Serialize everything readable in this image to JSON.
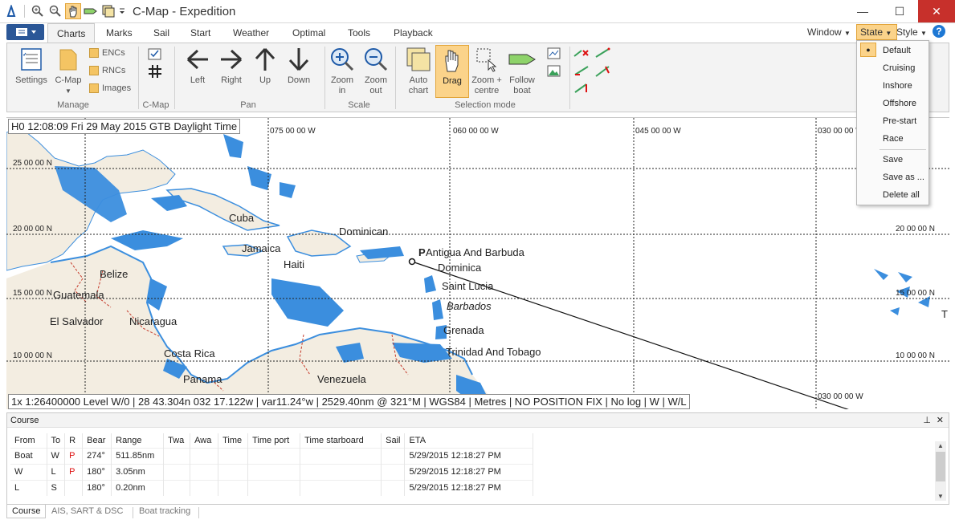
{
  "app": {
    "title": "C-Map - Expedition"
  },
  "window_controls": {
    "minimize": "—",
    "maximize": "☐",
    "close": "✕"
  },
  "ribbon_tabs": [
    "Charts",
    "Marks",
    "Sail",
    "Start",
    "Weather",
    "Optimal",
    "Tools",
    "Playback"
  ],
  "ribbon_right": {
    "window": "Window",
    "state": "State",
    "style": "Style",
    "help": "?"
  },
  "ribbon": {
    "settings": "Settings",
    "cmap": "C-Map",
    "encs": "ENCs",
    "rncs": "RNCs",
    "images": "Images",
    "left": "Left",
    "right": "Right",
    "up": "Up",
    "down": "Down",
    "zoom_in_1": "Zoom",
    "zoom_in_2": "in",
    "zoom_out_1": "Zoom",
    "zoom_out_2": "out",
    "auto_chart_1": "Auto",
    "auto_chart_2": "chart",
    "drag": "Drag",
    "zoom_centre_1": "Zoom +",
    "zoom_centre_2": "centre",
    "follow_boat_1": "Follow",
    "follow_boat_2": "boat",
    "groups": {
      "manage": "Manage",
      "cmap": "C-Map",
      "pan": "Pan",
      "scale": "Scale",
      "selection": "Selection mode"
    }
  },
  "map": {
    "time_readout": "H0 12:08:09 Fri 29 May 2015 GTB Daylight Time",
    "status_readout": "1x 1:26400000 Level W/0 | 28 43.304n 032 17.122w | var11.24°w | 2529.40nm @ 321°M | WGS84 | Metres | NO POSITION FIX | No log | W | W/L",
    "lon_labels": [
      "075 00 00 W",
      "060 00 00 W",
      "045 00 00 W",
      "030 00 00 W"
    ],
    "lat_labels": [
      "25 00 00 N",
      "20 00 00 N",
      "15 00 00 N",
      "10 00 00 N"
    ],
    "places": [
      "Cuba",
      "Dominican",
      "Jamaica",
      "Haiti",
      "Belize",
      "Guatemala",
      "El Salvador",
      "Nicaragua",
      "Costa Rica",
      "Panama",
      "Venezuela",
      "Antigua And Barbuda",
      "Dominica",
      "Saint Lucia",
      "Barbados",
      "Grenada",
      "Trinidad And Tobago"
    ],
    "mark_letter": "P",
    "right_edge_glyph": "T",
    "colors": {
      "land": "#f3ede1",
      "shallow": "#3b8ede",
      "coast": "#3b8ede",
      "border": "#c53a2a"
    }
  },
  "state_menu": {
    "items": [
      "Default",
      "Cruising",
      "Inshore",
      "Offshore",
      "Pre-start",
      "Race",
      "Save",
      "Save as ...",
      "Delete all"
    ],
    "selected": "Default"
  },
  "course": {
    "title": "Course",
    "pin": "⊥",
    "close": "✕",
    "columns": [
      "From",
      "To",
      "R",
      "Bear",
      "Range",
      "Twa",
      "Awa",
      "Time",
      "Time port",
      "Time starboard",
      "Sail",
      "ETA"
    ],
    "rows": [
      [
        "Boat",
        "W",
        "P",
        "274°",
        "511.85nm",
        "",
        "",
        "",
        "",
        "",
        "",
        "5/29/2015 12:18:27 PM"
      ],
      [
        "W",
        "L",
        "P",
        "180°",
        "3.05nm",
        "",
        "",
        "",
        "",
        "",
        "",
        "5/29/2015 12:18:27 PM"
      ],
      [
        "L",
        "S",
        "",
        "180°",
        "0.20nm",
        "",
        "",
        "",
        "",
        "",
        "",
        "5/29/2015 12:18:27 PM"
      ]
    ]
  },
  "bottom_tabs": [
    "Course",
    "AIS, SART & DSC",
    "Boat tracking"
  ]
}
